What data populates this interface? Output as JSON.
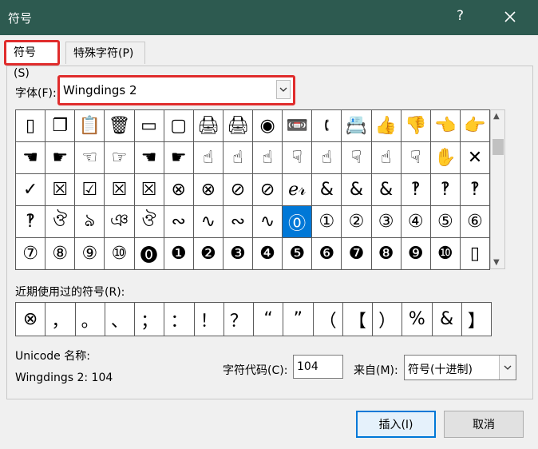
{
  "window": {
    "title": "符号",
    "help_label": "?"
  },
  "tabs": [
    {
      "label": "符号(S)"
    },
    {
      "label": "特殊字符(P)"
    }
  ],
  "font": {
    "label": "字体(F):",
    "value": "Wingdings 2"
  },
  "symbol_grid": {
    "selected_index": 57,
    "rows": [
      [
        "▯",
        "❐",
        "📋",
        "🗑",
        "▭",
        "▢",
        "🖨",
        "🖨",
        "◉",
        "📼",
        "🕻",
        "📇",
        "👍",
        "👎",
        "👈",
        "👉"
      ],
      [
        "☚",
        "☛",
        "☜",
        "☞",
        "☚",
        "☛",
        "☝",
        "☝",
        "☝",
        "☟",
        "☝",
        "☟",
        "☝",
        "☟",
        "✋",
        "✕"
      ],
      [
        "✓",
        "☒",
        "☑",
        "☒",
        "☒",
        "⊗",
        "⊗",
        "⊘",
        "⊘",
        "ℯ𝓇",
        "&",
        "&",
        "&",
        "‽",
        "‽",
        "‽"
      ],
      [
        "‽",
        "ঔ",
        "ঌ",
        "ঞ",
        "ঔ",
        "∾",
        "∿",
        "∾",
        "∿",
        "⓪",
        "①",
        "②",
        "③",
        "④",
        "⑤",
        "⑥"
      ],
      [
        "⑦",
        "⑧",
        "⑨",
        "⑩",
        "⓿",
        "❶",
        "❷",
        "❸",
        "❹",
        "❺",
        "❻",
        "❼",
        "❽",
        "❾",
        "❿",
        "▯"
      ]
    ]
  },
  "recent": {
    "label": "近期使用过的符号(R):",
    "symbols": [
      "⊗",
      "，",
      "。",
      "、",
      "；",
      "：",
      "！",
      "？",
      "“",
      "”",
      "（",
      "【",
      "）",
      "%",
      "&",
      "】"
    ]
  },
  "unicode": {
    "name_label": "Unicode 名称:",
    "name_value": "Wingdings 2: 104"
  },
  "char_code": {
    "label": "字符代码(C):",
    "value": "104"
  },
  "from": {
    "label": "来自(M):",
    "value": "符号(十进制)"
  },
  "buttons": {
    "insert": "插入(I)",
    "cancel": "取消"
  }
}
